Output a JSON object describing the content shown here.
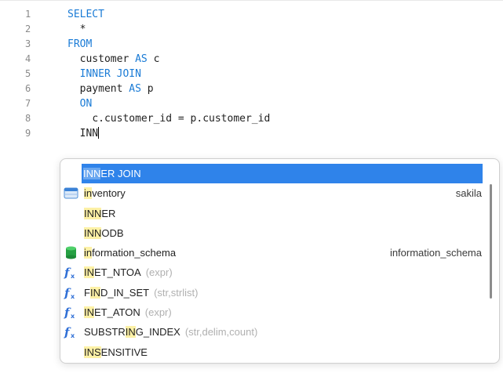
{
  "editor": {
    "line_numbers": [
      "1",
      "2",
      "3",
      "4",
      "5",
      "6",
      "7",
      "8",
      "9"
    ],
    "lines": [
      {
        "indent": "",
        "segments": [
          {
            "text": "SELECT",
            "kw": true
          }
        ]
      },
      {
        "indent": "  ",
        "segments": [
          {
            "text": "*",
            "kw": false
          }
        ]
      },
      {
        "indent": "",
        "segments": [
          {
            "text": "FROM",
            "kw": true
          }
        ]
      },
      {
        "indent": "  ",
        "segments": [
          {
            "text": "customer ",
            "kw": false
          },
          {
            "text": "AS",
            "kw": true
          },
          {
            "text": " c",
            "kw": false
          }
        ]
      },
      {
        "indent": "  ",
        "segments": [
          {
            "text": "INNER JOIN",
            "kw": true
          }
        ]
      },
      {
        "indent": "  ",
        "segments": [
          {
            "text": "payment ",
            "kw": false
          },
          {
            "text": "AS",
            "kw": true
          },
          {
            "text": " p",
            "kw": false
          }
        ]
      },
      {
        "indent": "  ",
        "segments": [
          {
            "text": "ON",
            "kw": true
          }
        ]
      },
      {
        "indent": "    ",
        "segments": [
          {
            "text": "c.customer_id = p.customer_id",
            "kw": false
          }
        ]
      },
      {
        "indent": "  ",
        "segments": [
          {
            "text": "INN",
            "kw": false
          }
        ],
        "cursor": true
      }
    ]
  },
  "autocomplete": {
    "typed": "INN",
    "items": [
      {
        "kind": "keyword",
        "icon": "",
        "pre": "",
        "match": "INN",
        "post": "ER JOIN",
        "params": "",
        "detail": "",
        "selected": true
      },
      {
        "kind": "table",
        "icon": "table-icon",
        "pre": "",
        "match": "in",
        "post": "ventory",
        "extra_hl_at": 3,
        "params": "",
        "detail": "sakila",
        "selected": false
      },
      {
        "kind": "keyword",
        "icon": "",
        "pre": "",
        "match": "INN",
        "post": "ER",
        "params": "",
        "detail": "",
        "selected": false
      },
      {
        "kind": "keyword",
        "icon": "",
        "pre": "",
        "match": "INN",
        "post": "ODB",
        "params": "",
        "detail": "",
        "selected": false
      },
      {
        "kind": "schema",
        "icon": "database-icon",
        "pre": "",
        "match": "in",
        "post": "formation_schema",
        "params": "",
        "detail": "information_schema",
        "selected": false
      },
      {
        "kind": "function",
        "icon": "function-icon",
        "pre": "",
        "match": "IN",
        "post": "ET_NTOA",
        "params": "(expr)",
        "detail": "",
        "selected": false
      },
      {
        "kind": "function",
        "icon": "function-icon",
        "pre": "F",
        "match": "IN",
        "post": "D_IN_SET",
        "params": "(str,strlist)",
        "detail": "",
        "selected": false
      },
      {
        "kind": "function",
        "icon": "function-icon",
        "pre": "",
        "match": "IN",
        "post": "ET_ATON",
        "params": "(expr)",
        "detail": "",
        "selected": false
      },
      {
        "kind": "function",
        "icon": "function-icon",
        "pre": "SUBSTR",
        "match": "IN",
        "post": "G_INDEX",
        "params": "(str,delim,count)",
        "detail": "",
        "selected": false
      },
      {
        "kind": "keyword",
        "icon": "",
        "pre": "",
        "match": "INS",
        "post": "ENSITIVE",
        "params": "",
        "detail": "",
        "selected": false
      }
    ]
  },
  "colors": {
    "keyword": "#1a7bd6",
    "selection": "#2f83ea",
    "match_highlight": "#fdf1a6",
    "function_icon": "#2f6fd6",
    "database_icon": "#26a043"
  }
}
